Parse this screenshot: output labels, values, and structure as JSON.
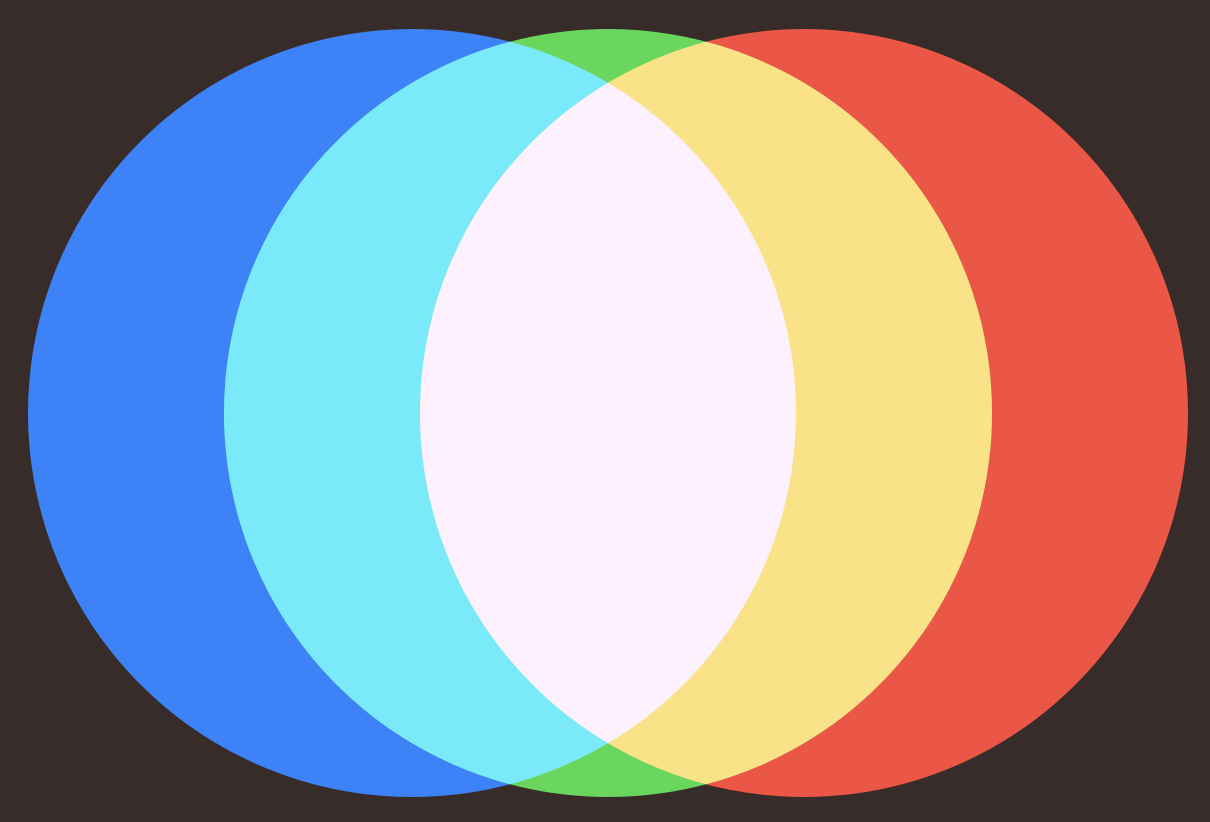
{
  "background_color": "#372c2a",
  "circles": [
    {
      "name": "blue-circle",
      "color": "#3d83f7"
    },
    {
      "name": "green-circle",
      "color": "#6bd65e"
    },
    {
      "name": "red-circle",
      "color": "#eb5747"
    }
  ],
  "overlaps": {
    "blue_green": "#7aeafb",
    "green_red": "#f9e287",
    "blue_green_red": "#fcf1fc"
  }
}
